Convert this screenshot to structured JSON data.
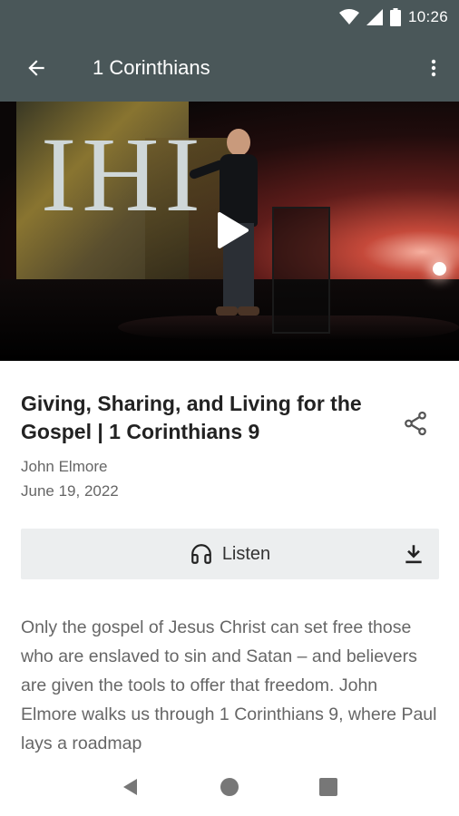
{
  "status_bar": {
    "time": "10:26",
    "icons": [
      "wifi-icon",
      "signal-icon",
      "battery-icon"
    ]
  },
  "app_bar": {
    "title": "1 Corinthians",
    "back_icon": "arrow-left-icon",
    "menu_icon": "more-vert-icon"
  },
  "video": {
    "play_icon": "play-icon",
    "background_letters": "IHI"
  },
  "sermon": {
    "title": "Giving, Sharing, and Living for the Gospel | 1 Corinthians 9",
    "speaker": "John Elmore",
    "date": "June 19, 2022",
    "share_icon": "share-icon"
  },
  "actions": {
    "listen_label": "Listen",
    "listen_icon": "headphones-icon",
    "download_icon": "download-icon"
  },
  "description": "Only the gospel of Jesus Christ can set free those who are enslaved to sin and Satan – and believers are given the tools to offer that freedom. John Elmore walks us through 1 Corinthians 9, where Paul lays a roadmap",
  "colors": {
    "app_bar": "#4a5759",
    "text_primary": "#222222",
    "text_secondary": "#666666",
    "listen_bg": "#eceeef"
  },
  "nav_bar": {
    "icons": [
      "back-triangle-icon",
      "home-circle-icon",
      "recents-square-icon"
    ]
  }
}
